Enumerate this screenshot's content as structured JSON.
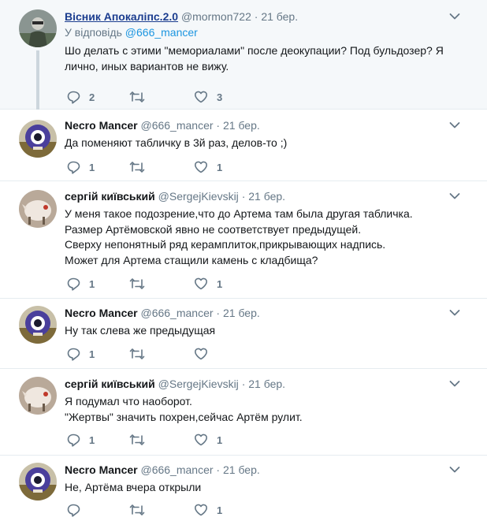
{
  "tweets": [
    {
      "name": "Вісник Апокаліпс.2.0",
      "handle": "@mormon722",
      "dot": "·",
      "time": "21 бер.",
      "reply_prefix": "У відповідь ",
      "reply_mention": "@666_mancer",
      "lines": [
        "Шо делать с этими \"мемориалами\" после деокупации? Под бульдозер? Я",
        "лично, иных вариантов не вижу."
      ],
      "reply_count": "2",
      "retweet_count": "",
      "like_count": "3"
    },
    {
      "name": "Necro Mancer",
      "handle": "@666_mancer",
      "dot": "·",
      "time": "21 бер.",
      "lines": [
        "Да поменяют табличку в 3й раз, делов-то ;)"
      ],
      "reply_count": "1",
      "retweet_count": "",
      "like_count": "1"
    },
    {
      "name": "сергій київський",
      "handle": "@SergejKievskij",
      "dot": "·",
      "time": "21 бер.",
      "lines": [
        "У меня такое подозрение,что до Артема там была другая табличка.",
        "Размер Артёмовской явно не соответствует предыдущей.",
        "Сверху непонятный ряд керамплиток,прикрывающих  надпись.",
        "Может для Артема стащили камень с кладбища?"
      ],
      "reply_count": "1",
      "retweet_count": "",
      "like_count": "1"
    },
    {
      "name": "Necro Mancer",
      "handle": "@666_mancer",
      "dot": "·",
      "time": "21 бер.",
      "lines": [
        "Ну так слева же предыдущая"
      ],
      "reply_count": "1",
      "retweet_count": "",
      "like_count": ""
    },
    {
      "name": "сергій київський",
      "handle": "@SergejKievskij",
      "dot": "·",
      "time": "21 бер.",
      "lines": [
        "Я подумал что наоборот.",
        "\"Жертвы\"  значить похрен,сейчас Артём рулит."
      ],
      "reply_count": "1",
      "retweet_count": "",
      "like_count": "1"
    },
    {
      "name": "Necro Mancer",
      "handle": "@666_mancer",
      "dot": "·",
      "time": "21 бер.",
      "lines": [
        "Не, Артёма вчера открыли"
      ],
      "reply_count": "",
      "retweet_count": "",
      "like_count": "1"
    }
  ],
  "icons": {
    "reply": "reply-icon",
    "retweet": "retweet-icon",
    "like": "heart-icon",
    "menu": "chevron-down-icon"
  },
  "colors": {
    "icon": "#657786",
    "thread_line": "#ccd6dd",
    "focused_bg": "#f5f8fa",
    "mention": "#1b95e0"
  }
}
